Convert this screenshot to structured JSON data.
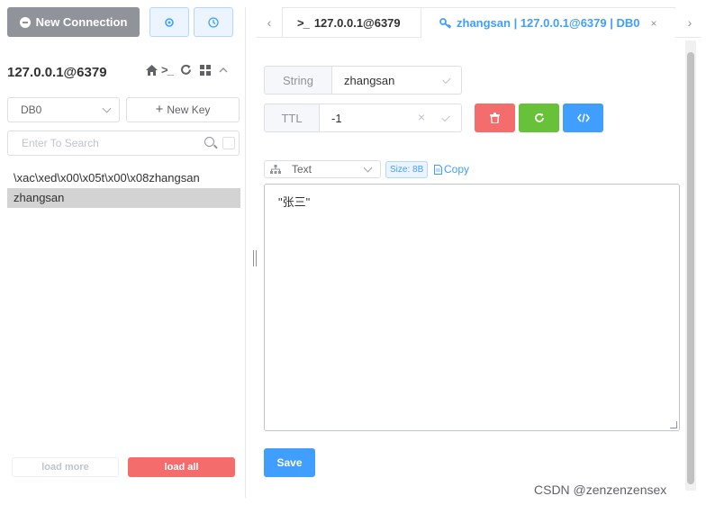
{
  "toolbar": {
    "new_connection_label": "New Connection"
  },
  "connection": {
    "title": "127.0.0.1@6379"
  },
  "db_select": {
    "value": "DB0"
  },
  "new_key_label": "New Key",
  "search": {
    "placeholder": "Enter To Search"
  },
  "keys": [
    "\\xac\\xed\\x00\\x05t\\x00\\x08zhangsan",
    "zhangsan"
  ],
  "load_more_label": "load more",
  "load_all_label": "load all",
  "tabs": [
    {
      "label": "127.0.0.1@6379",
      "prefix": ">_"
    },
    {
      "label": "zhangsan | 127.0.0.1@6379 | DB0",
      "close": "×"
    }
  ],
  "key_detail": {
    "type_label": "String",
    "key_name": "zhangsan",
    "ttl_label": "TTL",
    "ttl_value": "-1",
    "format": "Text",
    "size": "Size: 8B",
    "copy_label": "Copy",
    "value": "\"张三\"",
    "save_label": "Save"
  },
  "watermark": "CSDN @zenzenzensex",
  "colors": {
    "primary": "#409eff",
    "danger": "#f56c6c",
    "success": "#67c23a",
    "info": "#909399"
  }
}
